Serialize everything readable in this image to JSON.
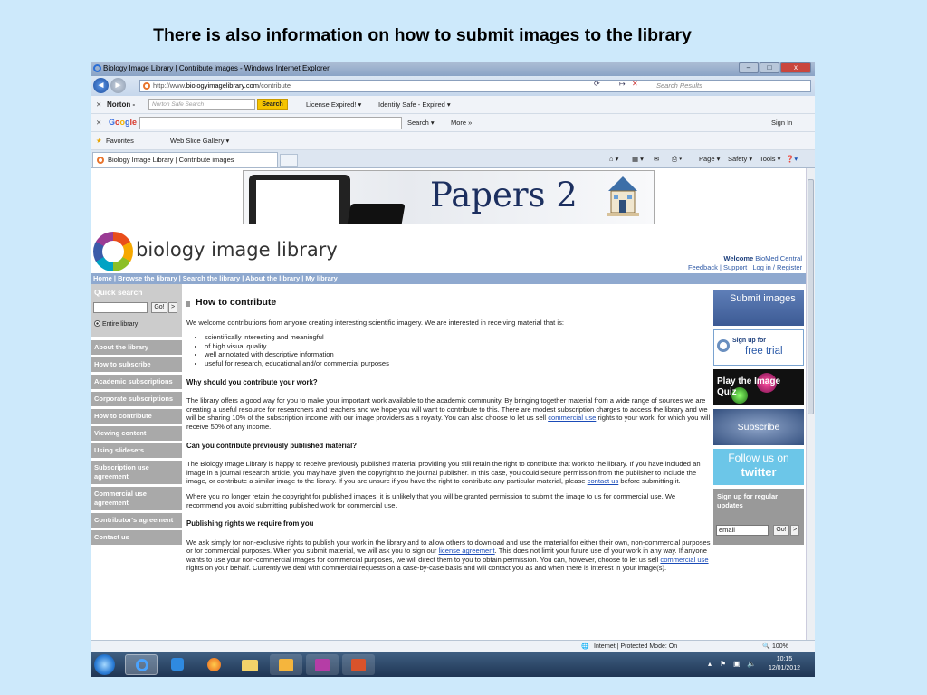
{
  "slide": {
    "title": "There is also information on how to submit images to the library"
  },
  "browser": {
    "window_title": "Biology Image Library | Contribute images - Windows Internet Explorer",
    "minimize": "–",
    "maximize": "□",
    "close": "x",
    "back": "◄",
    "forward": "►",
    "address_prefix": "http://www.",
    "address_domain": "biologyimagelibrary.com",
    "address_path": "/contribute",
    "search_placeholder": "Search Results",
    "norton": {
      "label": "Norton -",
      "placeholder": "Norton Safe Search",
      "button": "Search",
      "license": "License Expired! ▾",
      "identity": "Identity Safe - Expired ▾"
    },
    "google": {
      "search": "Search ▾",
      "more": "More »",
      "signin": "Sign In"
    },
    "favorites": {
      "label": "Favorites",
      "web_slice": "Web Slice Gallery ▾"
    },
    "tab_title": "Biology Image Library | Contribute images",
    "commands": {
      "page": "Page ▾",
      "safety": "Safety ▾",
      "tools": "Tools ▾"
    },
    "status": {
      "zone": "Internet | Protected Mode: On",
      "zoom": "100%"
    },
    "clock": {
      "time": "10:15",
      "date": "12/01/2012"
    }
  },
  "site": {
    "banner_text": "Papers 2",
    "name": "biology image library",
    "welcome_label": "Welcome",
    "welcome_user": "BioMed Central",
    "account_links": "Feedback | Support | Log in / Register",
    "nav": "Home | Browse the library | Search the library | About the library | My library",
    "quick_search": {
      "title": "Quick search",
      "go": "Go!",
      "arrow": ">",
      "scope": "Entire library"
    },
    "menu": [
      "About the library",
      "How to subscribe",
      "Academic subscriptions",
      "Corporate subscriptions",
      "How to contribute",
      "Viewing content",
      "Using slidesets",
      "Subscription use agreement",
      "Commercial use agreement",
      "Contributor's agreement",
      "Contact us"
    ],
    "promos": {
      "submit": "Submit images",
      "trial_small": "Sign up for",
      "trial": "free trial",
      "quiz": "Play the Image Quiz",
      "subscribe": "Subscribe",
      "twitter_top": "Follow us on",
      "twitter": "twitter",
      "updates": "Sign up for regular updates",
      "email": "email",
      "go": "Go!"
    }
  },
  "article": {
    "title": "How to contribute",
    "intro": "We welcome contributions from anyone creating interesting scientific imagery. We are interested in receiving material that is:",
    "bullets": [
      "scientifically interesting and meaningful",
      "of high visual quality",
      "well annotated with descriptive information",
      "useful for research, educational and/or commercial purposes"
    ],
    "h_why": "Why should you contribute your work?",
    "p_why_1": "The library offers a good way for you to make your important work available to the academic community. By bringing together material from a wide range of sources we are creating a useful resource for researchers and teachers and we hope you will want to contribute to this. There are modest subscription charges to access the library and we will be sharing 10% of the subscription income with our image providers as a royalty. You can also choose to let us sell",
    "link_commercial": "commercial use",
    "p_why_2": "rights to your work, for which you will receive 50% of any income.",
    "h_prev": "Can you contribute previously published material?",
    "p_prev_1": "The Biology Image Library is happy to receive previously published material providing you still retain the right to contribute that work to the library. If you have included an image in a journal research article, you may have given the copyright to the journal publisher. In this case, you could secure permission from the publisher to include the image, or contribute a similar image to the library. If you are unsure if you have the right to contribute any particular material, please",
    "link_contact": "contact us",
    "p_prev_2": "before submitting it.",
    "p_prev_3": "Where you no longer retain the copyright for published images, it is unlikely that you will be granted permission to submit the image to us for commercial use. We recommend you avoid submitting published work for commercial use.",
    "h_rights": "Publishing rights we require from you",
    "p_rights_1": "We ask simply for non-exclusive rights to publish your work in the library and to allow others to download and use the material for either their own, non-commercial purposes or for commercial purposes. When you submit material, we will ask you to sign our",
    "link_license": "license agreement",
    "p_rights_2": ". This does not limit your future use of your work in any way. If anyone wants to use your non-commercial images for commercial purposes, we will direct them to you to obtain permission. You can, however, choose to let us sell",
    "link_commercial_2": "commercial use",
    "p_rights_3": "rights on your behalf. Currently we deal with commercial requests on a case-by-case basis and will contact you as and when there is interest in your image(s)."
  }
}
